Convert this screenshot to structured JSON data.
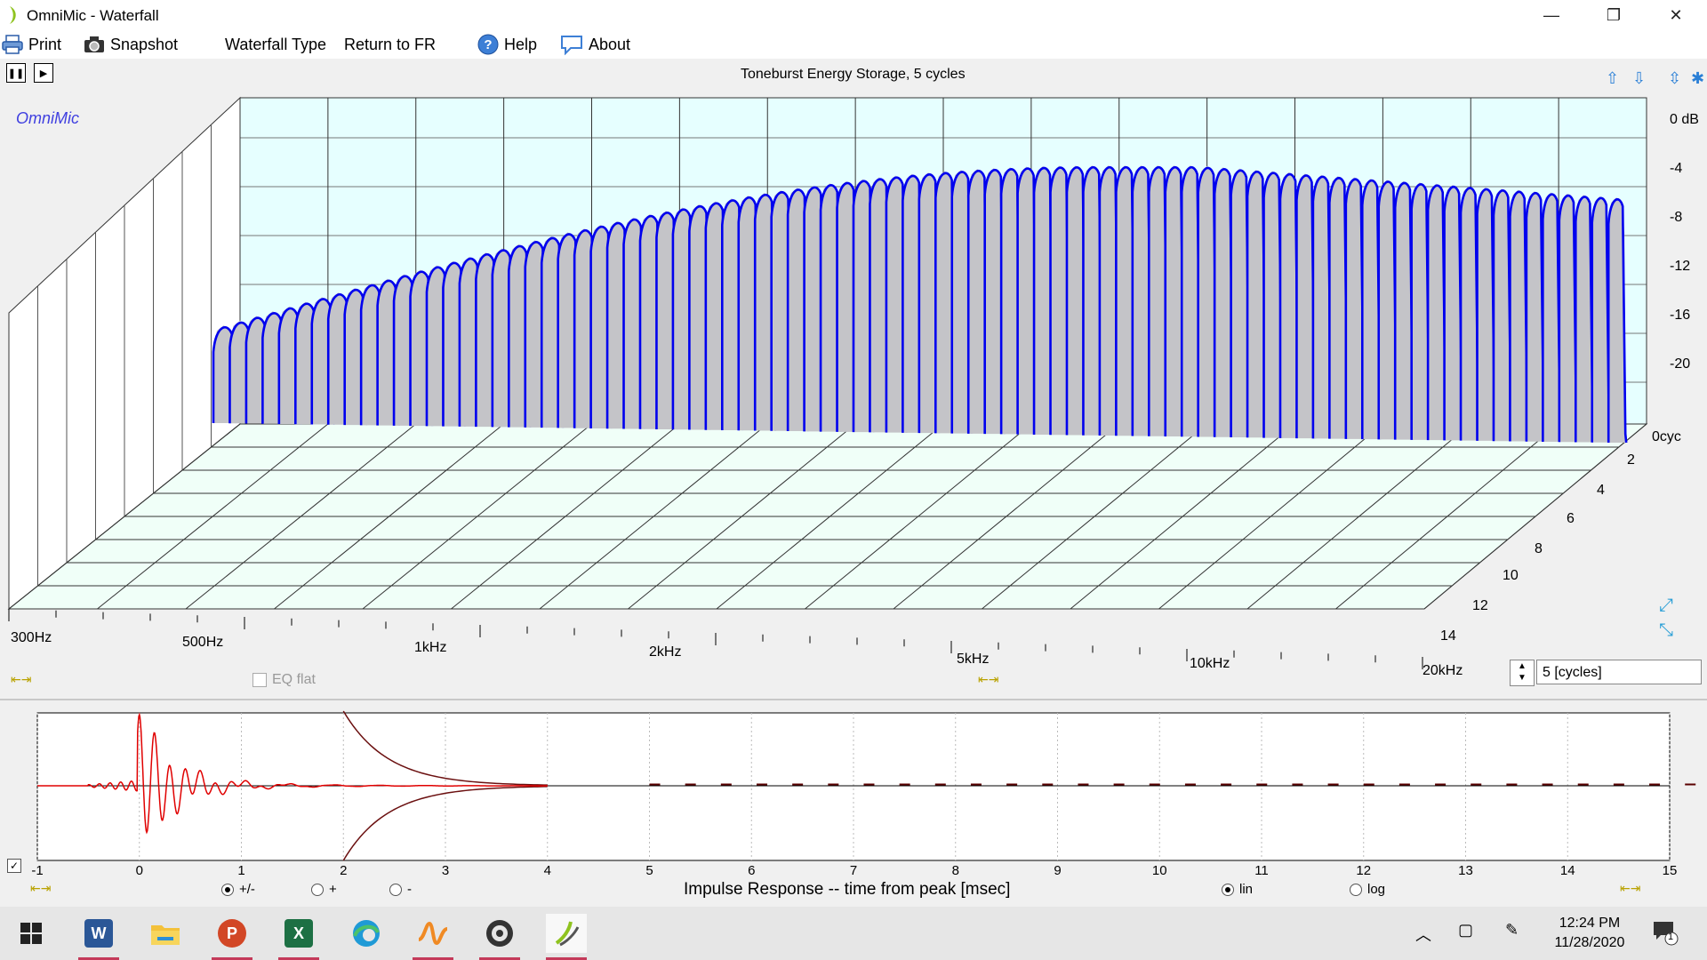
{
  "window": {
    "title": "OmniMic - Waterfall",
    "minimize": "—",
    "restore": "❐",
    "close": "✕"
  },
  "menu": {
    "print": "Print",
    "snapshot": "Snapshot",
    "waterfall_type": "Waterfall Type",
    "return_fr": "Return to FR",
    "help": "Help",
    "about": "About"
  },
  "waterfall": {
    "title": "Toneburst Energy Storage, 5 cycles",
    "brand": "OmniMic",
    "db_labels": [
      "0 dB",
      "-4",
      "-8",
      "-12",
      "-16",
      "-20"
    ],
    "cycle_labels": [
      "0cyc",
      "2",
      "4",
      "6",
      "8",
      "10",
      "12",
      "14"
    ],
    "freq_labels": [
      "300Hz",
      "500Hz",
      "1kHz",
      "2kHz",
      "5kHz",
      "10kHz",
      "20kHz"
    ],
    "eq_flat": "EQ flat",
    "cycles_value": "5 [cycles]",
    "colors": {
      "curve": "#0000ee",
      "fill": "#c4c4c8",
      "wall": "#e6ffff",
      "floor": "#f0fff8"
    }
  },
  "impulse": {
    "x_ticks": [
      "-1",
      "0",
      "1",
      "2",
      "3",
      "4",
      "5",
      "6",
      "7",
      "8",
      "9",
      "10",
      "11",
      "12",
      "13",
      "14",
      "15"
    ],
    "xlabel": "Impulse Response  -- time from peak [msec]",
    "radio_pm": "+/-",
    "radio_plus": "+",
    "radio_minus": "-",
    "radio_lin": "lin",
    "radio_log": "log",
    "colors": {
      "trace": "#e00000",
      "envelope": "#6b1010"
    }
  },
  "taskbar": {
    "time": "12:24 PM",
    "date": "11/28/2020",
    "notif_count": "1"
  }
}
